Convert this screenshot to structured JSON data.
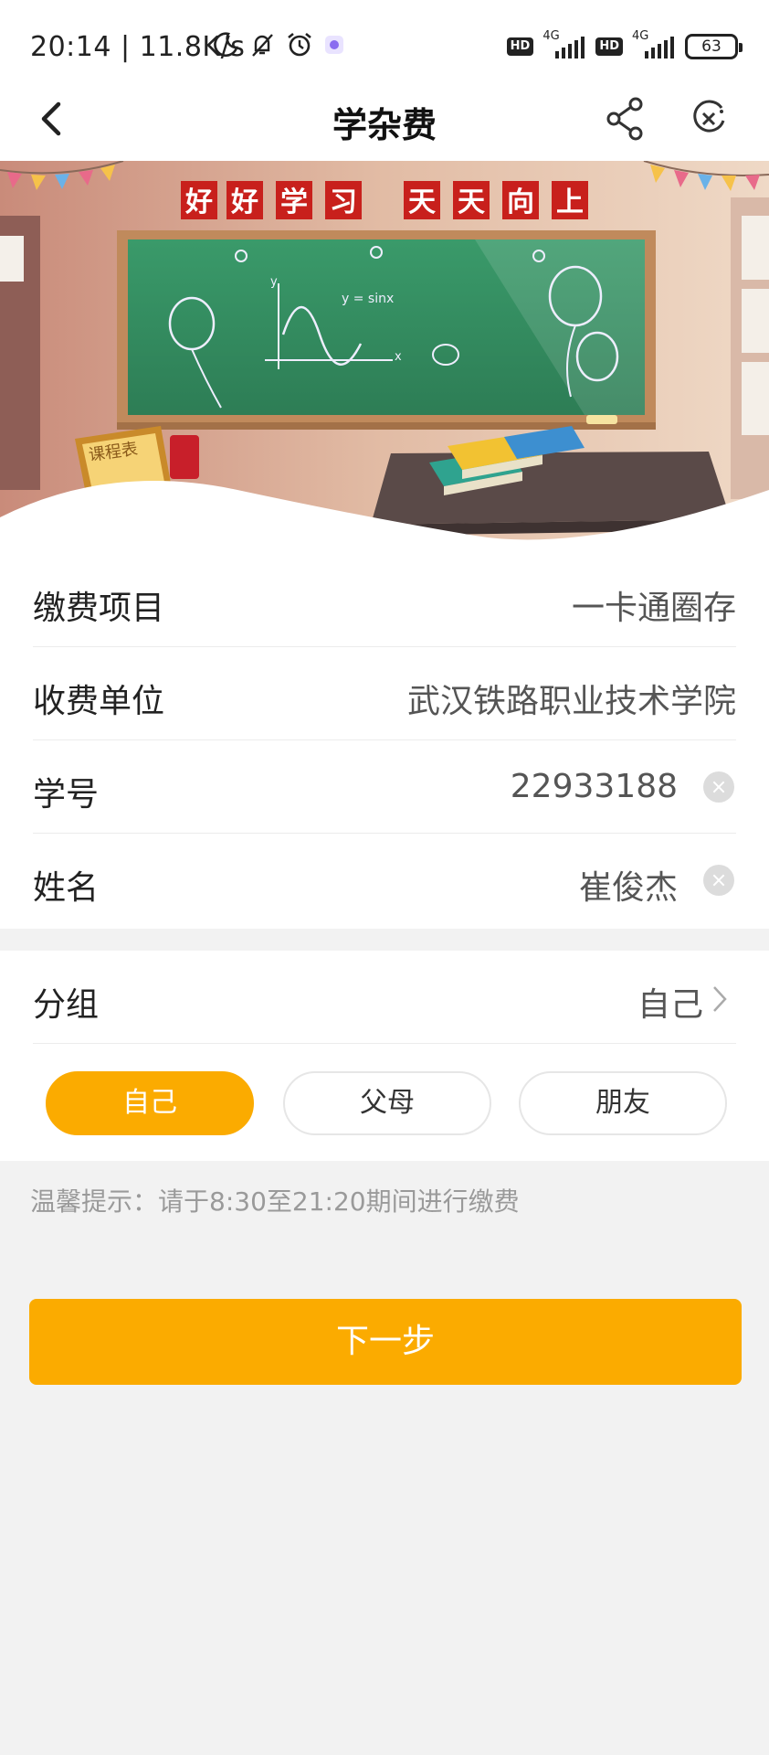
{
  "status_bar": {
    "time": "20:14 | 11.8K/s",
    "hd1": "HD",
    "net1": "4G",
    "hd2": "HD",
    "net2": "4G",
    "battery": "63"
  },
  "nav": {
    "title": "学杂费"
  },
  "banner": {
    "slogan_chars": [
      "好",
      "好",
      "学",
      "习",
      "天",
      "天",
      "向",
      "上"
    ],
    "board_formula": "y = sinx",
    "board_axis_y": "y",
    "board_axis_x": "x",
    "sign_text": "课程表"
  },
  "form": {
    "rows": [
      {
        "label": "缴费项目",
        "value": "一卡通圈存"
      },
      {
        "label": "收费单位",
        "value": "武汉铁路职业技术学院"
      },
      {
        "label": "学号",
        "value": "22933188"
      },
      {
        "label": "姓名",
        "value": "崔俊杰"
      }
    ]
  },
  "group": {
    "label": "分组",
    "value": "自己",
    "options": [
      "自己",
      "父母",
      "朋友"
    ],
    "selected_index": 0
  },
  "tip": "温馨提示：请于8:30至21:20期间进行缴费",
  "next_button": "下一步",
  "colors": {
    "accent": "#fbab00",
    "background": "#f2f2f2"
  }
}
